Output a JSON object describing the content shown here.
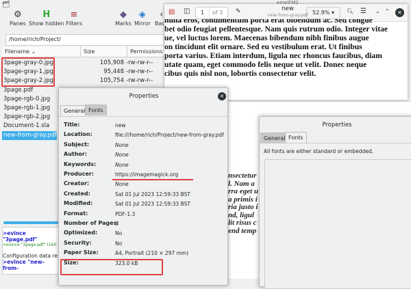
{
  "file_manager": {
    "title": "emelFM2",
    "toolbar": [
      {
        "label": "Panes",
        "icon": "panes-icon"
      },
      {
        "label": "Show hidden",
        "icon": "show-hidden-icon"
      },
      {
        "label": "Filters",
        "icon": "filters-icon"
      },
      {
        "label": "Marks",
        "icon": "marks-icon"
      },
      {
        "label": "Mirror",
        "icon": "mirror-icon"
      },
      {
        "label": "Back",
        "icon": "back-icon"
      }
    ],
    "path": "/home/rich/Project/",
    "columns": [
      "Filename",
      "Size",
      "Permissions"
    ],
    "files": [
      {
        "name": "3page-gray-0.jpg",
        "size": "105,908",
        "perm": "-rw-rw-r--"
      },
      {
        "name": "3page-gray-1.jpg",
        "size": "95,448",
        "perm": "-rw-rw-r--"
      },
      {
        "name": "3page-gray-2.jpg",
        "size": "105,754",
        "perm": "-rw-rw-r--"
      },
      {
        "name": "3page.pdf"
      },
      {
        "name": "3page-rgb-0.jpg"
      },
      {
        "name": "3page-rgb-1.jpg"
      },
      {
        "name": "3page-rgb-2.jpg"
      },
      {
        "name": "Document-1.sla"
      },
      {
        "name": "new-from-gray.pdf"
      }
    ],
    "console": [
      ">evince \"3page.pdf\"",
      ">evince \"3page.pdf\" (160",
      ">",
      "Configuration data re",
      ">evince \"new-from-"
    ]
  },
  "viewer": {
    "page": "1",
    "of": "of 3",
    "title": "new",
    "subtitle": "new-from-gray.pdf",
    "zoom": "52.9%",
    "text": [
      "nulla eros, condimentum porta erat bibendum ac. Sed congue",
      "bet odio feugiat pellentesque. Nam quis rutrum odio. Integer vitae",
      "ue, vel luctus lorem. Maecenas bibendum nibh finibus augue",
      "on tincidunt elit ornare. Sed eu vestibulum erat. Ut finibus",
      "porta varius. Etiam interdum, ligula nec rhoncus faucibus, diam",
      "utate quam, eget commodo felis neque ut velit. Donec neque",
      "cibus quis nisl non, lobortis consectetur velit."
    ],
    "text2": [
      "nsectetur",
      "l. Nam a",
      "rra eget u",
      "a primis i",
      "ria justo i",
      "nd, ligul",
      "lit risus c",
      "end temp"
    ]
  },
  "properties": {
    "title": "Properties",
    "tabs": [
      "General",
      "Fonts"
    ],
    "rows": [
      {
        "label": "Title:",
        "value": "new"
      },
      {
        "label": "Location:",
        "value": "file:///home/rich/Project/new-from-gray.pdf"
      },
      {
        "label": "Subject:",
        "value": "None"
      },
      {
        "label": "Author:",
        "value": "None"
      },
      {
        "label": "Keywords:",
        "value": "None"
      },
      {
        "label": "Producer:",
        "value": "https://imagemagick.org"
      },
      {
        "label": "Creator:",
        "value": "None"
      },
      {
        "label": "Created:",
        "value": "Sat 01 Jul 2023 12:59:33 BST"
      },
      {
        "label": "Modified:",
        "value": "Sat 01 Jul 2023 12:59:33 BST"
      },
      {
        "label": "Format:",
        "value": "PDF-1.3"
      },
      {
        "label": "Number of Pages:",
        "value": "3"
      },
      {
        "label": "Optimized:",
        "value": "No"
      },
      {
        "label": "Security:",
        "value": "No"
      },
      {
        "label": "Paper Size:",
        "value": "A4, Portrait (210 × 297 mm)"
      },
      {
        "label": "Size:",
        "value": "323.0 kB"
      }
    ]
  },
  "fonts_dialog": {
    "title": "Properties",
    "tabs": [
      "General",
      "Fonts"
    ],
    "message": "All fonts are either standard or embedded."
  },
  "colors": {
    "selection": "#3daee9",
    "annotation": "#e02020"
  }
}
